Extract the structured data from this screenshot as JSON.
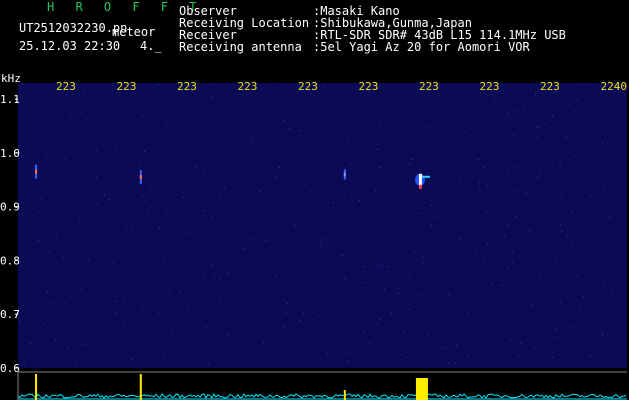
{
  "header": {
    "app_title": "H R O F F T",
    "filename": "UT2512032230.pn",
    "filename_suffix": "meteor",
    "timestamp": "25.12.03 22:30",
    "gain_value": "4._",
    "rows": [
      {
        "label": "Observer",
        "value": ":Masaki Kano"
      },
      {
        "label": "Receiving Location",
        "value": ":Shibukawa,Gunma,Japan"
      },
      {
        "label": "Receiver",
        "value": ":RTL-SDR SDR# 43dB L15 114.1MHz USB"
      },
      {
        "label": "Receiving antenna",
        "value": ":5el Yagi Az 20 for Aomori VOR"
      }
    ]
  },
  "colors": {
    "background": "#000000",
    "text": "#ffffff",
    "title": "#22c85a",
    "axis_labels": "#f0e000",
    "spectrum": "#0a0a55",
    "power_trace": "#00e8ff",
    "echo": "#ffee00"
  },
  "chart_data": {
    "type": "heatmap",
    "y_axis_label": "kHz",
    "y_ticks": [
      "1.1",
      "1.0",
      "0.9",
      "0.8",
      "0.7",
      "0.6"
    ],
    "y_range": [
      0.6,
      1.13
    ],
    "x_ticks": [
      "223",
      "223",
      "223",
      "223",
      "223",
      "223",
      "223",
      "223",
      "223",
      "2240"
    ],
    "x_range_minutes": [
      0,
      10
    ],
    "echoes": [
      {
        "time_min": 0.28,
        "freq_khz": 0.965,
        "intensity": "medium"
      },
      {
        "time_min": 2.0,
        "freq_khz": 0.955,
        "intensity": "medium"
      },
      {
        "time_min": 5.35,
        "freq_khz": 0.96,
        "intensity": "weak"
      },
      {
        "time_min": 6.6,
        "freq_khz": 0.95,
        "intensity": "strong"
      }
    ]
  }
}
